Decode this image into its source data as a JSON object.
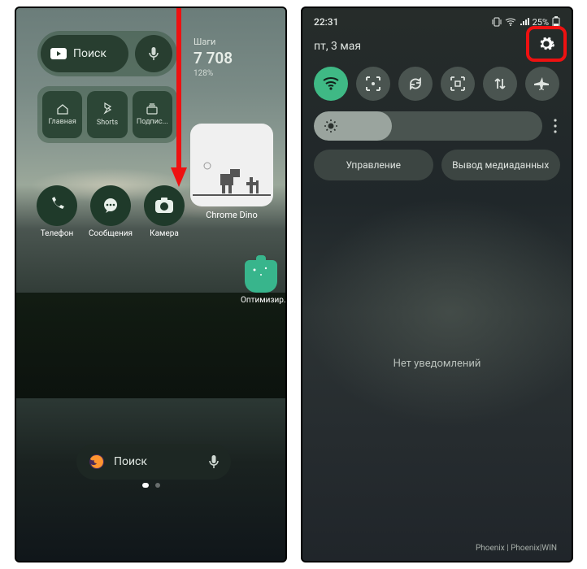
{
  "left": {
    "search_widget": {
      "label": "Поиск"
    },
    "steps": {
      "label": "Шаги",
      "value": "7 708",
      "percent": "128%"
    },
    "yt_tabs": [
      {
        "label": "Главная"
      },
      {
        "label": "Shorts"
      },
      {
        "label": "Подпис..."
      }
    ],
    "dino_label": "Chrome Dino",
    "apps": [
      {
        "label": "Телефон"
      },
      {
        "label": "Сообщения"
      },
      {
        "label": "Камера"
      }
    ],
    "optimize_label": "Оптимизир.",
    "firefox_search": "Поиск"
  },
  "right": {
    "time": "22:31",
    "battery": "25%",
    "date": "пт, 3 мая",
    "pills": {
      "control": "Управление",
      "media": "Вывод медиаданных"
    },
    "no_notifications": "Нет уведомлений",
    "footer": "Phoenix | Phoenix|WIN"
  }
}
